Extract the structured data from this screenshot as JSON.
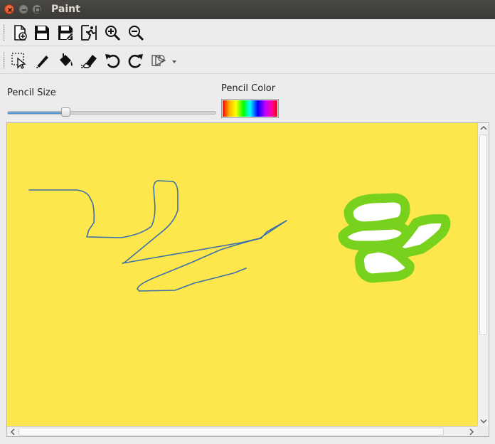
{
  "window": {
    "title": "Paint"
  },
  "toolbar_main": [
    {
      "name": "new-file-icon",
      "label": ""
    },
    {
      "name": "save-icon",
      "label": ""
    },
    {
      "name": "save-as-icon",
      "label": ""
    },
    {
      "name": "exit-icon",
      "label": ""
    },
    {
      "name": "zoom-in-icon",
      "label": ""
    },
    {
      "name": "zoom-out-icon",
      "label": ""
    }
  ],
  "toolbar_tools": [
    {
      "name": "select-icon"
    },
    {
      "name": "pencil-icon"
    },
    {
      "name": "fill-bucket-icon"
    },
    {
      "name": "eraser-icon"
    },
    {
      "name": "undo-icon"
    },
    {
      "name": "redo-icon"
    },
    {
      "name": "shapes-icon"
    }
  ],
  "controls": {
    "pencil_size_label": "Pencil Size",
    "pencil_size_value": 0.28,
    "pencil_color_label": "Pencil Color"
  },
  "canvas": {
    "background_color": "#fde74c",
    "stroke_colors": [
      "#3d6fa8",
      "#78d11d"
    ]
  }
}
